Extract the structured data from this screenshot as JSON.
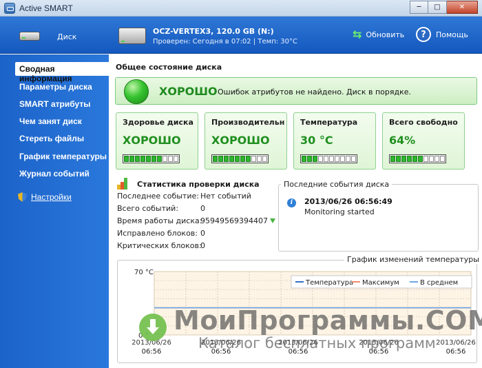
{
  "window": {
    "title": "Active SMART",
    "controls": {
      "minimize": "─",
      "maximize": "□",
      "close": "✕"
    }
  },
  "header": {
    "disk_label": "Диск",
    "drive_title": "OCZ-VERTEX3, 120.0 GB (N:)",
    "drive_status": "Проверен: Сегодня в 07:02 | Темп: 30°C",
    "refresh_label": "Обновить",
    "help_label": "Помощь",
    "help_glyph": "?"
  },
  "sidebar": {
    "items": [
      {
        "label": "Сводная информация"
      },
      {
        "label": "Параметры диска"
      },
      {
        "label": "SMART атрибуты"
      },
      {
        "label": "Чем занят диск"
      },
      {
        "label": "Стереть файлы"
      },
      {
        "label": "График температуры"
      },
      {
        "label": "Журнал событий"
      }
    ],
    "settings_label": "Настройки"
  },
  "main": {
    "section_title": "Общее состояние диска",
    "status_word": "ХОРОШО",
    "status_message": "Ошибок атрибутов не найдено. Диск в порядке.",
    "cards": [
      {
        "caption": "Здоровье диска",
        "value": "ХОРОШО",
        "level": 0.7
      },
      {
        "caption": "Производительн",
        "value": "ХОРОШО",
        "level": 0.7
      },
      {
        "caption": "Температура",
        "value": "30 °C",
        "level": 0.3
      },
      {
        "caption": "Всего свободно",
        "value": "64%",
        "level": 0.6
      }
    ],
    "stats": {
      "title": "Статистика проверки диска",
      "rows": [
        {
          "label": "Последнее событие:",
          "value": "Нет событий"
        },
        {
          "label": "Всего событий:",
          "value": "0"
        },
        {
          "label": "Время работы диска:",
          "value": "95949569394407"
        },
        {
          "label": "Исправлено блоков:",
          "value": "0"
        },
        {
          "label": "Критических блоков:",
          "value": "0"
        }
      ]
    },
    "events": {
      "title": "Последние события диска",
      "items": [
        {
          "time": "2013/06/26 06:56:49",
          "message": "Monitoring started"
        }
      ]
    }
  },
  "chart_data": {
    "type": "line",
    "title": "График изменений температуры",
    "ylim": [
      0,
      70
    ],
    "y_ticks": [
      "70 °C",
      "0 °"
    ],
    "x_ticks": [
      {
        "date": "2013/06/26",
        "time": "06:56"
      },
      {
        "date": "2013/06/26",
        "time": "06:56"
      },
      {
        "date": "2013/06/26",
        "time": "06:56"
      },
      {
        "date": "2013/06/26",
        "time": "06:56"
      },
      {
        "date": "2013/06/26",
        "time": "06:56"
      }
    ],
    "legend": [
      "Температура",
      "Максимум",
      "В среднем"
    ],
    "legend_position": "top-right",
    "series": [
      {
        "name": "Температура",
        "values": [
          30,
          30,
          30,
          30,
          30
        ],
        "color": "#2f6fc9"
      },
      {
        "name": "Максимум",
        "values": [
          30,
          30,
          30,
          30,
          30
        ],
        "color": "#f08a6a"
      },
      {
        "name": "В среднем",
        "values": [
          30,
          30,
          30,
          30,
          30
        ],
        "color": "#6aa8e8"
      }
    ],
    "grid": true
  },
  "watermark": {
    "title": "МоиПрограммы.COM",
    "subtitle": "Каталог бесплатных программ"
  },
  "colors": {
    "accent": "#1d67cc",
    "good": "#1f8f1f"
  }
}
